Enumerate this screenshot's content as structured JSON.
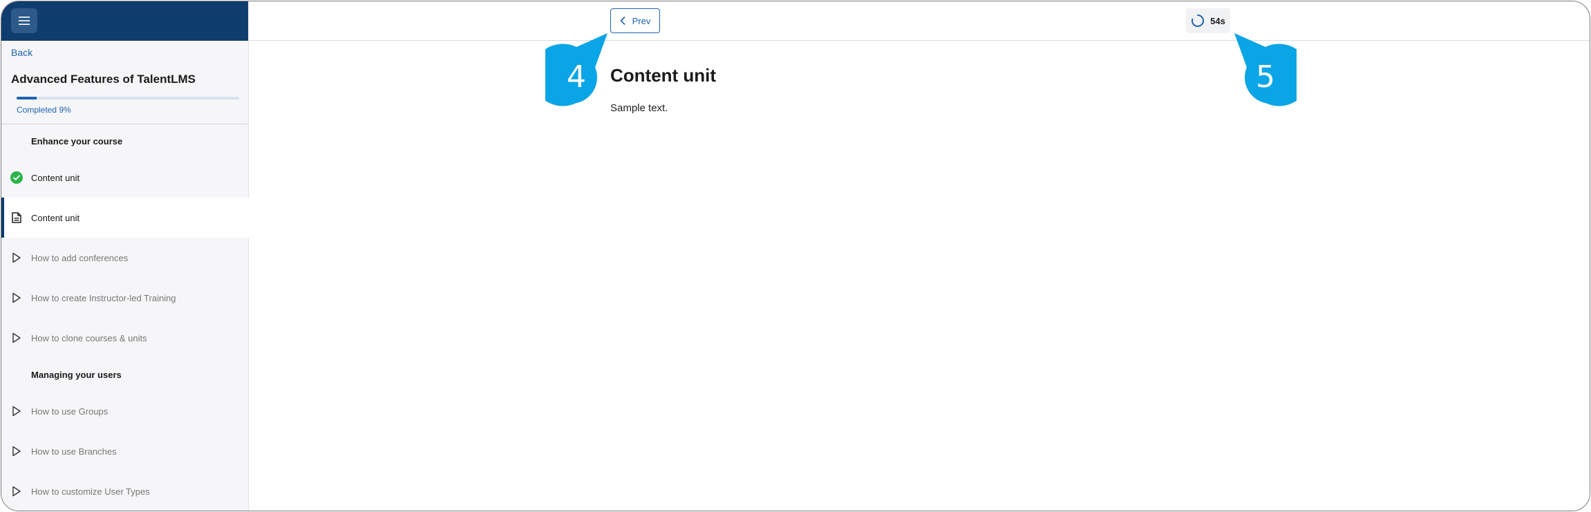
{
  "sidebar": {
    "back_label": "Back",
    "course_title": "Advanced Features of TalentLMS",
    "progress": {
      "percent": 9,
      "label": "Completed 9%"
    },
    "sections": [
      {
        "title": "Enhance your course",
        "units": [
          {
            "label": "Content unit",
            "status": "completed",
            "icon": "check-circle-icon"
          },
          {
            "label": "Content unit",
            "status": "active",
            "icon": "document-icon"
          },
          {
            "label": "How to add conferences",
            "status": "pending",
            "icon": "play-icon"
          },
          {
            "label": "How to create Instructor-led Training",
            "status": "pending",
            "icon": "play-icon"
          },
          {
            "label": "How to clone courses & units",
            "status": "pending",
            "icon": "play-icon"
          }
        ]
      },
      {
        "title": "Managing your users",
        "units": [
          {
            "label": "How to use Groups",
            "status": "pending",
            "icon": "play-icon"
          },
          {
            "label": "How to use Branches",
            "status": "pending",
            "icon": "play-icon"
          },
          {
            "label": "How to customize User Types",
            "status": "pending",
            "icon": "play-icon"
          }
        ]
      }
    ]
  },
  "topbar": {
    "prev_label": "Prev",
    "timer_label": "54s"
  },
  "content": {
    "title": "Content unit",
    "body": "Sample text."
  },
  "callouts": [
    {
      "number": "4"
    },
    {
      "number": "5"
    }
  ],
  "colors": {
    "brand_dark": "#0f3d6e",
    "accent": "#1d64b0",
    "callout": "#0aa5e6",
    "success": "#2db34a"
  }
}
